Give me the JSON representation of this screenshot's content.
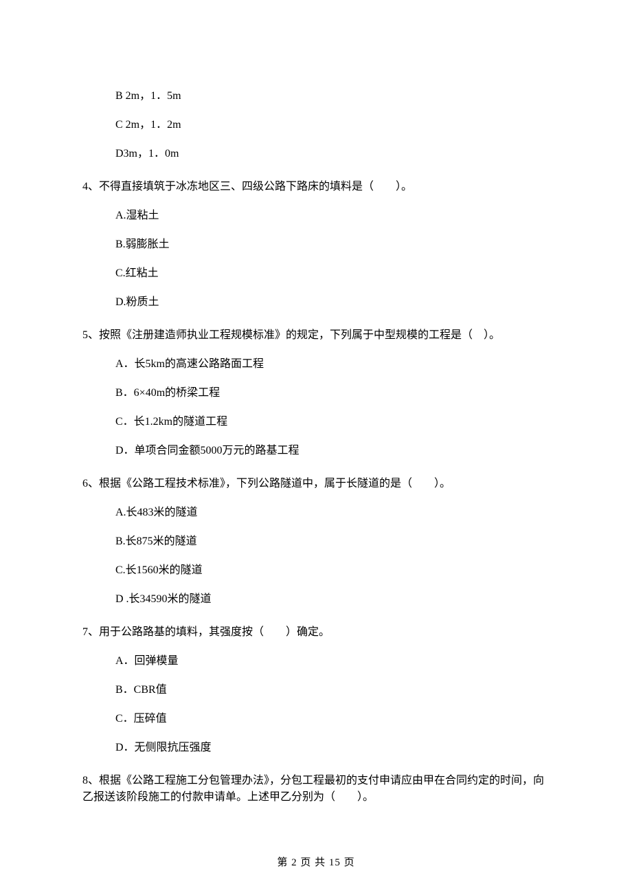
{
  "q3": {
    "optB": "B 2m，1．5m",
    "optC": "C 2m，1．2m",
    "optD": "D3m，1．0m"
  },
  "q4": {
    "stem": "4、不得直接填筑于冰冻地区三、四级公路下路床的填料是（　　）。",
    "optA": "A.湿粘土",
    "optB": "B.弱膨胀土",
    "optC": "C.红粘土",
    "optD": "D.粉质土"
  },
  "q5": {
    "stem": "5、按照《注册建造师执业工程规模标准》的规定，下列属于中型规模的工程是（　）。",
    "optA": "A．长5km的高速公路路面工程",
    "optB": "B．6×40m的桥梁工程",
    "optC": "C．长1.2km的隧道工程",
    "optD": "D．单项合同金额5000万元的路基工程"
  },
  "q6": {
    "stem": "6、根据《公路工程技术标准》，下列公路隧道中，属于长隧道的是（　　）。",
    "optA": "A.长483米的隧道",
    "optB": "B.长875米的隧道",
    "optC": "C.长1560米的隧道",
    "optD": "D .长34590米的隧道"
  },
  "q7": {
    "stem": "7、用于公路路基的填料，其强度按（　　）确定。",
    "optA": "A．回弹模量",
    "optB": "B．CBR值",
    "optC": "C．压碎值",
    "optD": "D．无侧限抗压强度"
  },
  "q8": {
    "stem": "8、根据《公路工程施工分包管理办法》，分包工程最初的支付申请应由甲在合同约定的时间，向乙报送该阶段施工的付款申请单。上述甲乙分别为（　　）。"
  },
  "footer": "第 2 页 共 15 页"
}
